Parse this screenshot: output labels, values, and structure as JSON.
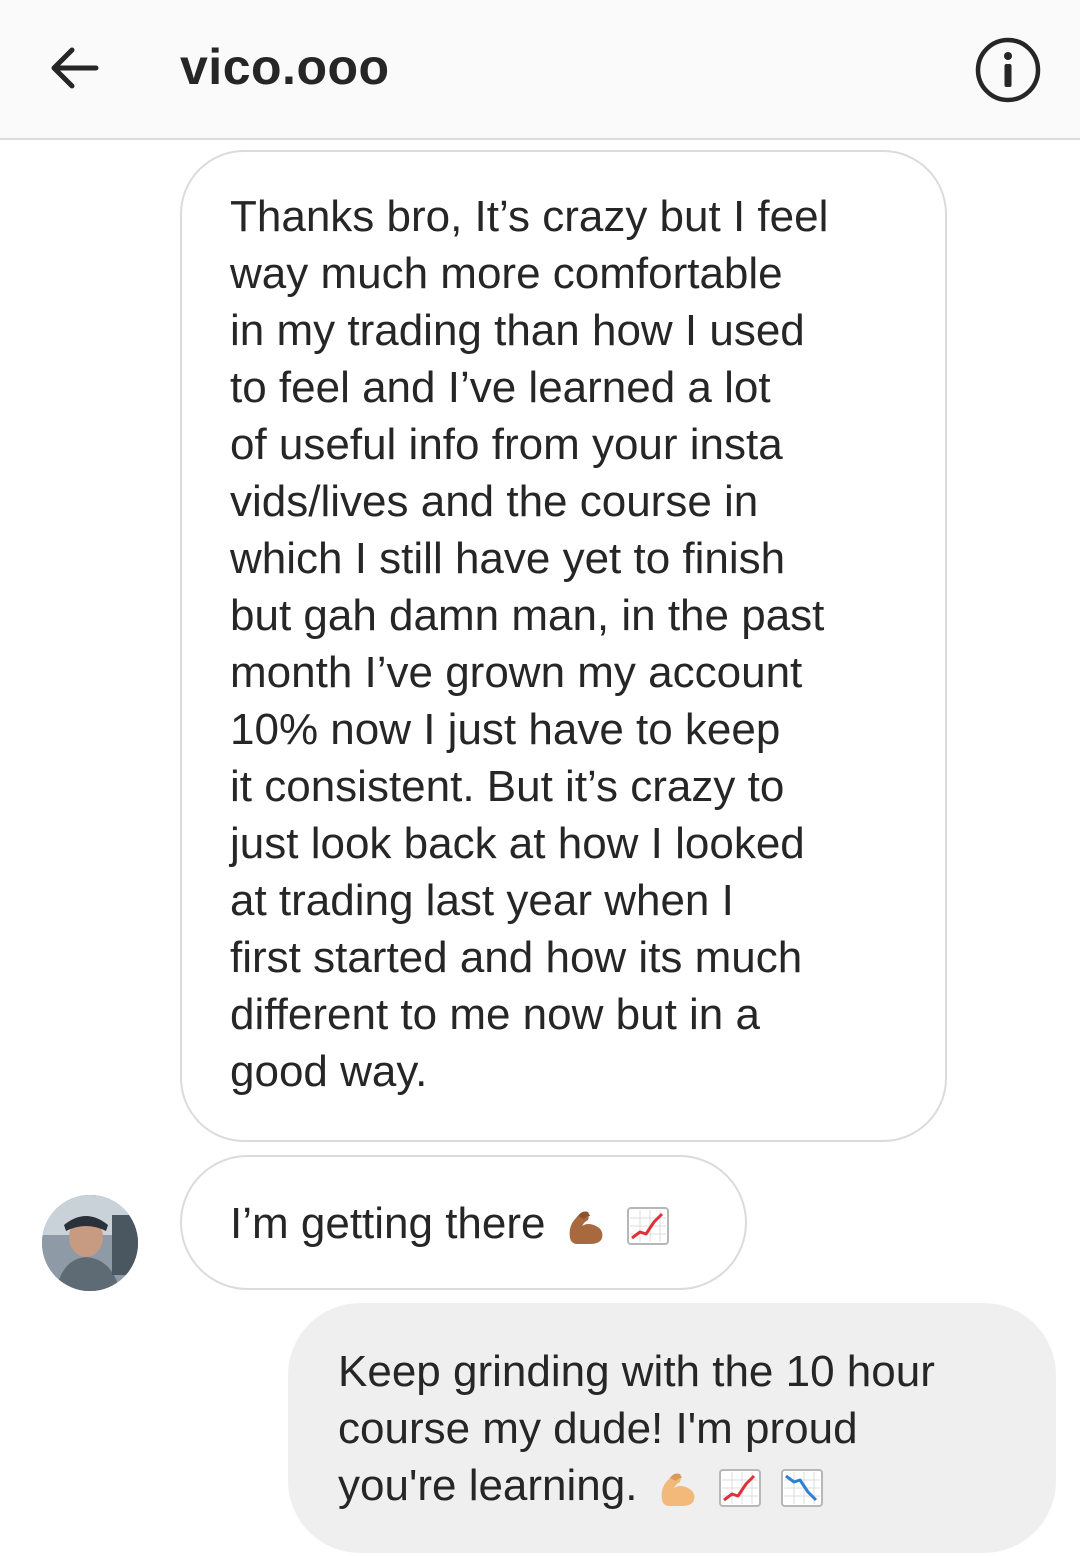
{
  "header": {
    "title": "vico.ooo"
  },
  "messages": [
    {
      "sender": "them",
      "lines": [
        "Thanks bro, It’s crazy but I feel",
        "way much more comfortable",
        "in my trading than how I used",
        "to feel and I’ve learned a lot",
        "of useful info from your insta",
        "vids/lives and the course in",
        "which I still have yet to finish",
        "but gah damn man, in the past",
        "month I’ve grown my account",
        "10% now I just have to keep",
        "it consistent. But it’s crazy to",
        "just look back at how I looked",
        "at trading last year when I",
        "first started and how its much",
        "different to me now but in a",
        "good way."
      ]
    },
    {
      "sender": "them",
      "text": "I’m getting there",
      "emojis": [
        "flexed-biceps-icon",
        "chart-increasing-icon"
      ]
    },
    {
      "sender": "me",
      "lines": [
        "Keep grinding with the 10 hour",
        "course my dude! I'm proud",
        "you're learning."
      ],
      "emojis": [
        "flexed-biceps-icon",
        "chart-increasing-icon",
        "chart-decreasing-icon"
      ]
    }
  ],
  "colors": {
    "header_bg": "#fafafa",
    "incoming_border": "#dbdbdb",
    "outgoing_bg": "#efefef",
    "text": "#262626"
  }
}
